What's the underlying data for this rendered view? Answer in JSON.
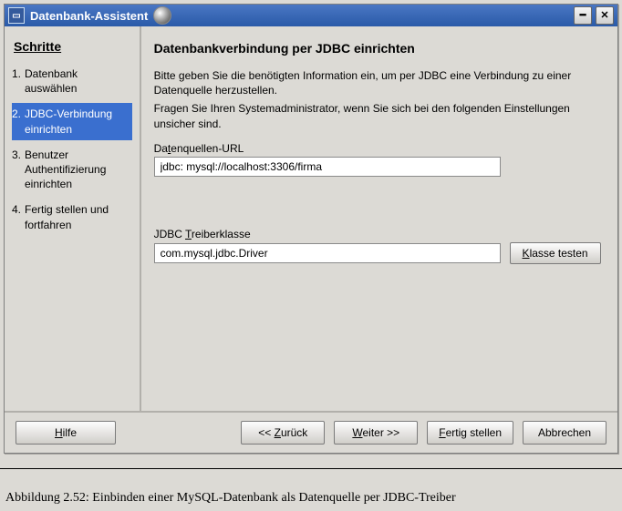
{
  "window": {
    "title": "Datenbank-Assistent"
  },
  "sidebar": {
    "heading": "Schritte",
    "steps": [
      {
        "num": "1.",
        "label": "Datenbank auswählen"
      },
      {
        "num": "2.",
        "label": "JDBC-Verbindung einrichten"
      },
      {
        "num": "3.",
        "label": "Benutzer Authentifizierung einrichten"
      },
      {
        "num": "4.",
        "label": "Fertig stellen und fortfahren"
      }
    ],
    "selected_index": 1
  },
  "page": {
    "title": "Datenbankverbindung per JDBC einrichten",
    "instr1": "Bitte geben Sie die benötigten Information ein, um per JDBC eine Verbindung zu einer Datenquelle herzustellen.",
    "instr2": "Fragen Sie Ihren Systemadministrator, wenn Sie sich bei den folgenden Einstellungen unsicher sind.",
    "url_label_pre": "Da",
    "url_label_mn": "t",
    "url_label_post": "enquellen-URL",
    "url_value": "jdbc: mysql://localhost:3306/firma",
    "driver_label_pre": "JDBC ",
    "driver_label_mn": "T",
    "driver_label_post": "reiberklasse",
    "driver_value": "com.mysql.jdbc.Driver",
    "test_pre": "",
    "test_mn": "K",
    "test_post": "lasse testen"
  },
  "footer": {
    "help_mn": "H",
    "help_post": "ilfe",
    "back_pre": "<< ",
    "back_mn": "Z",
    "back_post": "urück",
    "next_mn": "W",
    "next_post": "eiter >>",
    "finish_mn": "F",
    "finish_post": "ertig stellen",
    "cancel": "Abbrechen"
  },
  "caption": "Abbildung 2.52: Einbinden einer MySQL-Datenbank als Datenquelle per JDBC-Treiber"
}
